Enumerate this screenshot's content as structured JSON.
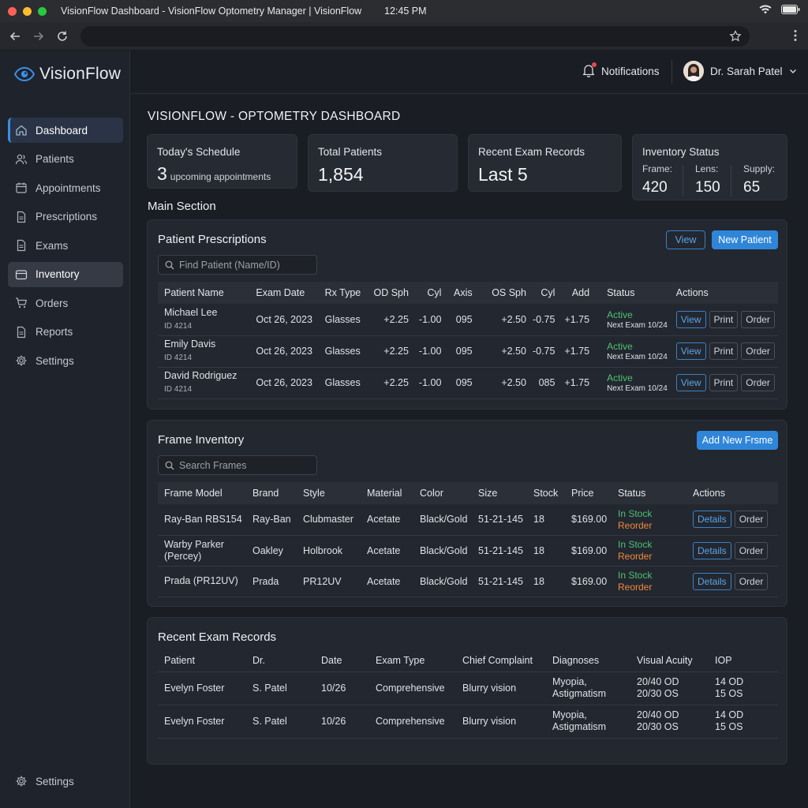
{
  "window": {
    "title": "VisionFlow Dashboard - VisionFlow Optometry Manager | VisionFlow",
    "clock": "12:45 PM"
  },
  "brand": {
    "name": "VisionFlow"
  },
  "sidebar": {
    "items": [
      {
        "label": "Dashboard",
        "icon": "home-icon",
        "state": "active"
      },
      {
        "label": "Patients",
        "icon": "users-icon"
      },
      {
        "label": "Appointments",
        "icon": "calendar-icon"
      },
      {
        "label": "Prescriptions",
        "icon": "document-icon"
      },
      {
        "label": "Exams",
        "icon": "document-icon"
      },
      {
        "label": "Inventory",
        "icon": "box-icon",
        "state": "highlighted"
      },
      {
        "label": "Orders",
        "icon": "cart-icon"
      },
      {
        "label": "Reports",
        "icon": "document-icon"
      },
      {
        "label": "Settings",
        "icon": "gear-icon"
      }
    ],
    "bottom_label": "Settings"
  },
  "header": {
    "notifications_label": "Notifications",
    "user_name": "Dr. Sarah Patel"
  },
  "page_title": "VISIONFLOW - OPTOMETRY DASHBOARD",
  "cards": {
    "schedule": {
      "label": "Today's Schedule",
      "value": "3",
      "sub": "upcoming appointments"
    },
    "patients": {
      "label": "Total Patients",
      "value": "1,854"
    },
    "exams": {
      "label": "Recent Exam Records",
      "value": "Last 5"
    },
    "inventory": {
      "label": "Inventory Status",
      "frame_label": "Frame:",
      "frame_value": "420",
      "lens_label": "Lens:",
      "lens_value": "150",
      "supply_label": "Supply:",
      "supply_value": "65"
    }
  },
  "main_section_label": "Main Section",
  "prescriptions": {
    "title": "Patient Prescriptions",
    "view_label": "View",
    "new_label": "New Patient",
    "search_placeholder": "Find Patient (Name/ID)",
    "columns": [
      "Patient Name",
      "Exam Date",
      "Rx Type",
      "OD Sph",
      "Cyl",
      "Axis",
      "OS Sph",
      "Cyl",
      "Add",
      "Status",
      "Actions"
    ],
    "rows": [
      {
        "name": "Michael Lee",
        "id": "ID 4214",
        "date": "Oct 26, 2023",
        "rx": "Glasses",
        "od_sph": "+2.25",
        "od_cyl": "-1.00",
        "axis": "095",
        "os_sph": "+2.50",
        "os_cyl": "-0.75",
        "add": "+1.75",
        "status": "Active",
        "next": "Next Exam 10/24"
      },
      {
        "name": "Emily Davis",
        "id": "ID 4214",
        "date": "Oct 26, 2023",
        "rx": "Glasses",
        "od_sph": "+2.25",
        "od_cyl": "-1.00",
        "axis": "095",
        "os_sph": "+2.50",
        "os_cyl": "-0.75",
        "add": "+1.75",
        "status": "Active",
        "next": "Next Exam 10/24"
      },
      {
        "name": "David Rodriguez",
        "id": "ID 4214",
        "date": "Oct 26, 2023",
        "rx": "Glasses",
        "od_sph": "+2.25",
        "od_cyl": "-1.00",
        "axis": "095",
        "os_sph": "+2.50",
        "os_cyl": "085",
        "add": "+1.75",
        "status": "Active",
        "next": "Next Exam 10/24"
      }
    ],
    "actions": [
      "View",
      "Print",
      "Order"
    ]
  },
  "frames": {
    "title": "Frame Inventory",
    "add_label": "Add New Frsme",
    "search_placeholder": "Search Frames",
    "columns": [
      "Frame Model",
      "Brand",
      "Style",
      "Material",
      "Color",
      "Size",
      "Stock",
      "Price",
      "Status",
      "Actions"
    ],
    "rows": [
      {
        "model": "Ray-Ban RBS154",
        "model2": "",
        "brand": "Ray-Ban",
        "style": "Clubmaster",
        "material": "Acetate",
        "color": "Black/Gold",
        "size": "51-21-145",
        "stock": "18",
        "price": "$169.00",
        "status1": "In Stock",
        "status2": "Reorder"
      },
      {
        "model": "Warby Parker",
        "model2": "(Percey)",
        "brand": "Oakley",
        "style": "Holbrook",
        "material": "Acetate",
        "color": "Black/Gold",
        "size": "51-21-145",
        "stock": "18",
        "price": "$169.00",
        "status1": "In Stock",
        "status2": "Reorder"
      },
      {
        "model": "Prada (PR12UV)",
        "model2": "",
        "brand": "Prada",
        "style": "PR12UV",
        "material": "Acetate",
        "color": "Black/Gold",
        "size": "51-21-145",
        "stock": "18",
        "price": "$169.00",
        "status1": "In Stock",
        "status2": "Reorder"
      }
    ],
    "actions": [
      "Details",
      "Order"
    ]
  },
  "exams": {
    "title": "Recent Exam Records",
    "columns": [
      "Patient",
      "Dr.",
      "Date",
      "Exam Type",
      "Chief Complaint",
      "Diagnoses",
      "Visual Acuity",
      "IOP"
    ],
    "rows": [
      {
        "patient": "Evelyn Foster",
        "dr": "S. Patel",
        "date": "10/26",
        "type": "Comprehensive",
        "complaint": "Blurry vision",
        "dx1": "Myopia,",
        "dx2": "Astigmatism",
        "va1": "20/40 OD",
        "va2": "20/30 OS",
        "iop1": "14 OD",
        "iop2": "15 OS"
      },
      {
        "patient": "Evelyn Foster",
        "dr": "S. Patel",
        "date": "10/26",
        "type": "Comprehensive",
        "complaint": "Blurry vision",
        "dx1": "Myopia,",
        "dx2": "Astigmatism",
        "va1": "20/40 OD",
        "va2": "20/30 OS",
        "iop1": "14 OD",
        "iop2": "15 OS"
      }
    ]
  },
  "colors": {
    "accent": "#2f86d8",
    "active_green": "#4cc26f",
    "reorder_orange": "#f08a3c",
    "bg": "#1a1d24"
  }
}
